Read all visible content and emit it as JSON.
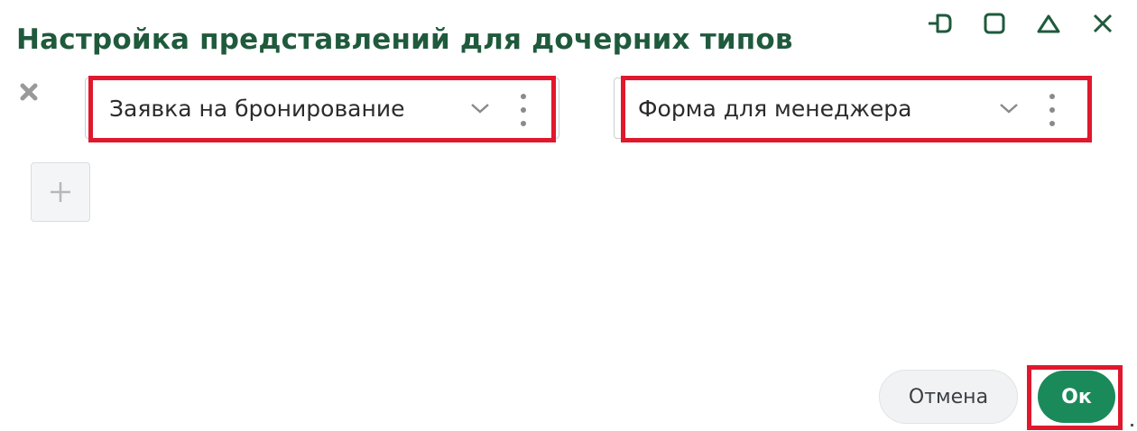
{
  "dialog": {
    "title": "Настройка представлений для дочерних типов",
    "window_controls": [
      "unpin-icon",
      "maximize-icon",
      "minimize-icon",
      "close-icon"
    ]
  },
  "rows": [
    {
      "type_value": "Заявка на бронирование",
      "form_value": "Форма для менеджера"
    }
  ],
  "footer": {
    "cancel_label": "Отмена",
    "ok_label": "Ок"
  },
  "colors": {
    "title": "#1f5a3c",
    "primary": "#1b8a5a",
    "highlight": "#e0182d"
  }
}
